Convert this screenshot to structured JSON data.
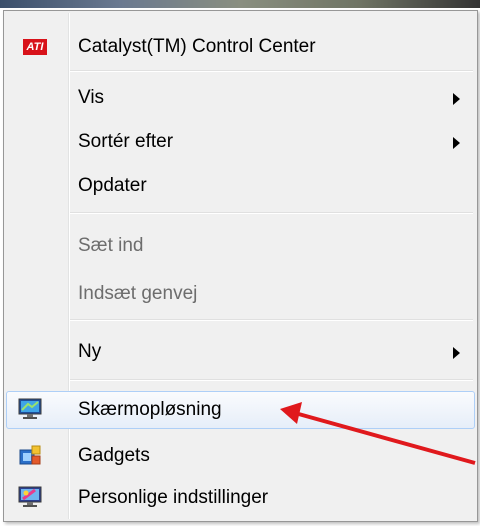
{
  "menu": {
    "items": [
      {
        "label": "Catalyst(TM) Control Center",
        "icon": "ati-logo",
        "logo_text": "ATI",
        "enabled": true,
        "has_submenu": false
      },
      {
        "label": "Vis",
        "enabled": true,
        "has_submenu": true
      },
      {
        "label": "Sortér efter",
        "enabled": true,
        "has_submenu": true
      },
      {
        "label": "Opdater",
        "enabled": true,
        "has_submenu": false
      },
      {
        "label": "Sæt ind",
        "enabled": false,
        "has_submenu": false
      },
      {
        "label": "Indsæt genvej",
        "enabled": false,
        "has_submenu": false
      },
      {
        "label": "Ny",
        "enabled": true,
        "has_submenu": true
      },
      {
        "label": "Skærmopløsning",
        "icon": "display-icon",
        "enabled": true,
        "has_submenu": false,
        "highlighted": true
      },
      {
        "label": "Gadgets",
        "icon": "gadgets-icon",
        "enabled": true,
        "has_submenu": false
      },
      {
        "label": "Personlige indstillinger",
        "icon": "personalize-icon",
        "enabled": true,
        "has_submenu": false
      }
    ]
  },
  "annotation": {
    "type": "arrow",
    "color": "#e0191d",
    "points_to": "Skærmopløsning"
  },
  "colors": {
    "menu_bg": "#f0f0f0",
    "highlight_border": "#aecff7",
    "disabled_text": "#6d6d6d"
  }
}
